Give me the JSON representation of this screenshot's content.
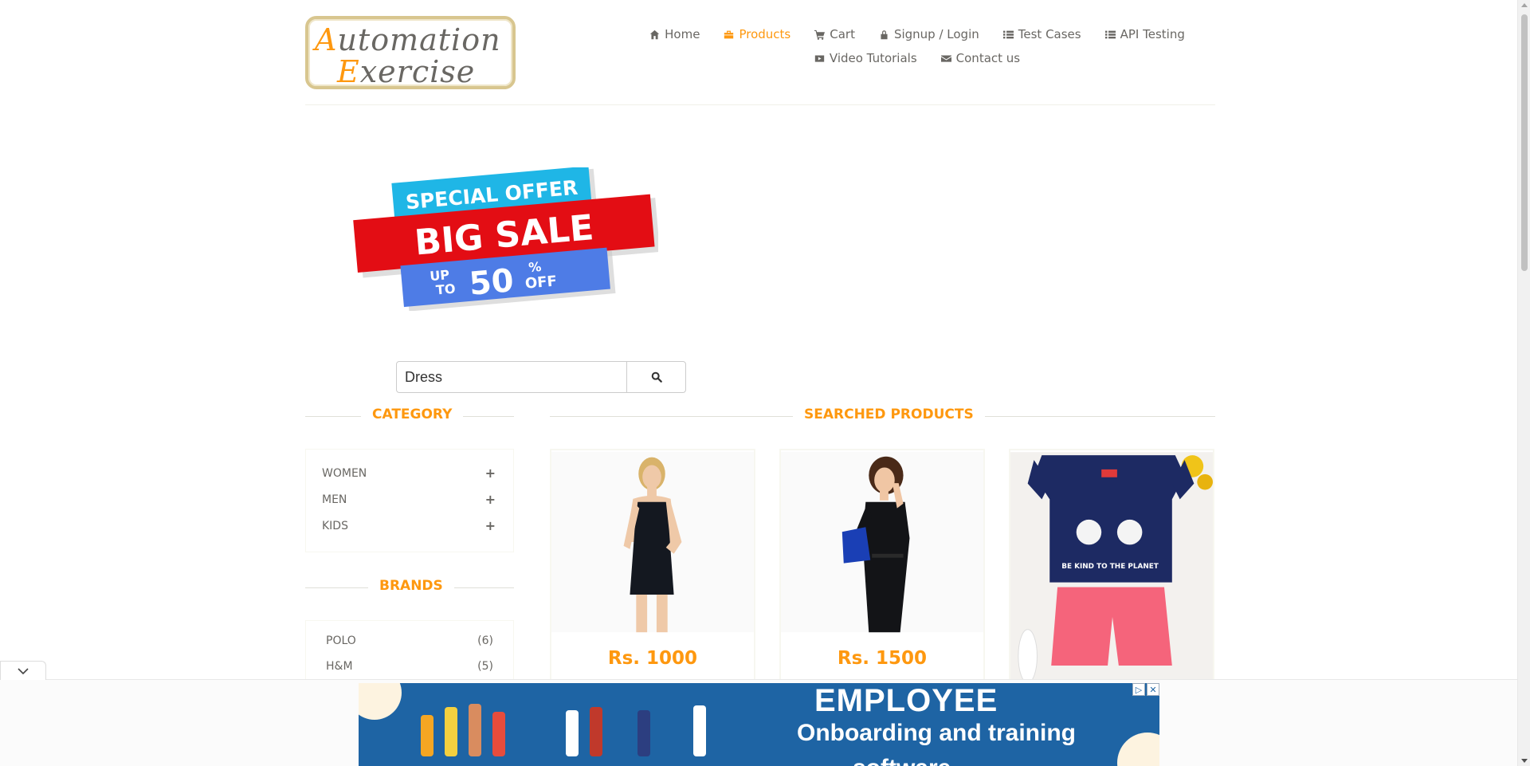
{
  "logo": {
    "line1_cap": "A",
    "line1_rest": "utomation",
    "line2_cap": "E",
    "line2_rest": "xercise"
  },
  "nav": {
    "row1": [
      {
        "label": "Home",
        "icon": "home-icon"
      },
      {
        "label": "Products",
        "icon": "products-icon",
        "active": true
      },
      {
        "label": "Cart",
        "icon": "cart-icon"
      },
      {
        "label": "Signup / Login",
        "icon": "lock-icon"
      },
      {
        "label": "Test Cases",
        "icon": "list-icon"
      },
      {
        "label": "API Testing",
        "icon": "list-icon"
      }
    ],
    "row2": [
      {
        "label": "Video Tutorials",
        "icon": "youtube-icon"
      },
      {
        "label": "Contact us",
        "icon": "envelope-icon"
      }
    ]
  },
  "banner": {
    "top": "SPECIAL OFFER",
    "main": "BIG SALE",
    "up": "UP",
    "to": "TO",
    "pct": "50",
    "pct_sign": "%",
    "off": "OFF"
  },
  "search": {
    "value": "Dress"
  },
  "category": {
    "title": "CATEGORY",
    "items": [
      {
        "label": "WOMEN"
      },
      {
        "label": "MEN"
      },
      {
        "label": "KIDS"
      }
    ]
  },
  "brands": {
    "title": "BRANDS",
    "items": [
      {
        "label": "POLO",
        "count": "(6)"
      },
      {
        "label": "H&M",
        "count": "(5)"
      }
    ]
  },
  "products": {
    "title": "SEARCHED PRODUCTS",
    "items": [
      {
        "price": "Rs. 1000"
      },
      {
        "price": "Rs. 1500"
      },
      {
        "price": ""
      }
    ],
    "tshirt_text": "BE KIND TO THE PLANET"
  },
  "ad": {
    "title": "EMPLOYEE",
    "subtitle": "Onboarding and training",
    "subtitle2": "software"
  },
  "colors": {
    "accent": "#fe980f",
    "text": "#696763",
    "ad_bg": "#1e64a4"
  }
}
